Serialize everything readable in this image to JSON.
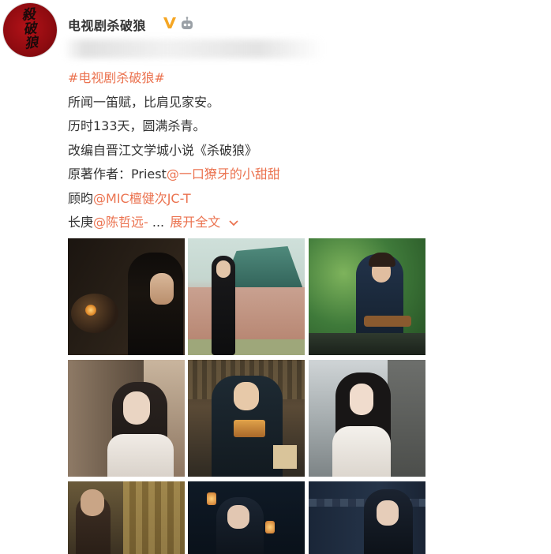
{
  "post": {
    "author_name": "电视剧杀破狼",
    "avatar_lettering": "殺破狼",
    "verified_icon": "verified-v-icon",
    "robot_icon": "robot-icon",
    "hashtag": "#电视剧杀破狼#",
    "lines": [
      "所闻一笛赋，比肩见家安。",
      "历时133天，圆满杀青。",
      "改编自晋江文学城小说《杀破狼》"
    ],
    "author_line": {
      "text": "原著作者：Priest",
      "mention": "@一口獠牙的小甜甜"
    },
    "gu_line": {
      "text": "顾昀",
      "mention": "@MIC檀健次JC-T"
    },
    "changgeng_line": {
      "text": "长庚",
      "mention": "@陈哲远-",
      "ellipsis": " ... ",
      "expand": "展开全文"
    }
  },
  "colors": {
    "link": "#eb7350",
    "text": "#333333",
    "avatar_bg": "#9e0e14",
    "verified": "#f5a623"
  },
  "images": [
    {
      "name": "photo-1",
      "caption": ""
    },
    {
      "name": "photo-2",
      "caption": ""
    },
    {
      "name": "photo-3",
      "caption": ""
    },
    {
      "name": "photo-4",
      "caption": ""
    },
    {
      "name": "photo-5",
      "caption": ""
    },
    {
      "name": "photo-6",
      "caption": ""
    },
    {
      "name": "photo-7",
      "caption": ""
    },
    {
      "name": "photo-8",
      "caption": ""
    },
    {
      "name": "photo-9",
      "caption": ""
    }
  ]
}
